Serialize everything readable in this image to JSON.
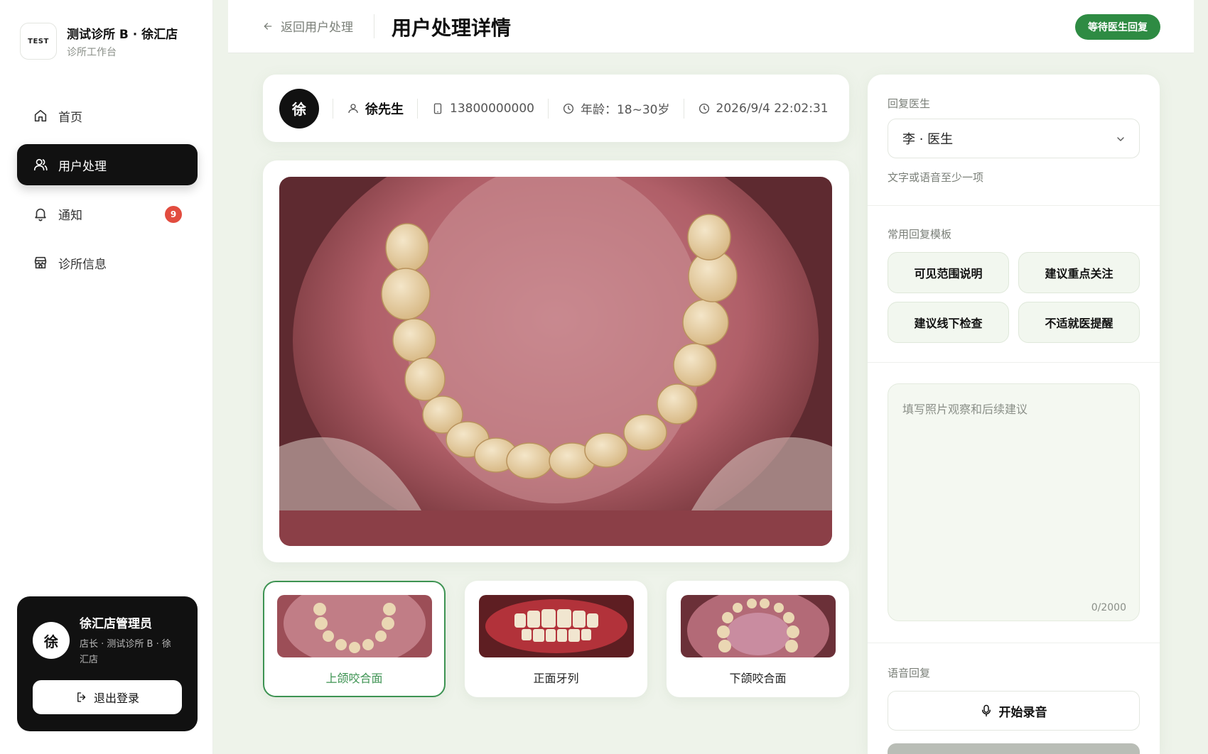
{
  "brand": {
    "logo_text": "TEST",
    "name": "测试诊所 B · 徐汇店",
    "subtitle": "诊所工作台"
  },
  "nav": {
    "items": [
      {
        "label": "首页",
        "icon": "home-icon"
      },
      {
        "label": "用户处理",
        "icon": "user-icon",
        "active": true
      },
      {
        "label": "通知",
        "icon": "bell-icon",
        "badge": "9"
      },
      {
        "label": "诊所信息",
        "icon": "store-icon"
      }
    ]
  },
  "user_card": {
    "avatar": "徐",
    "name": "徐汇店管理员",
    "role": "店长 · 测试诊所 B · 徐汇店",
    "logout_label": "退出登录"
  },
  "header": {
    "back_label": "返回用户处理",
    "title": "用户处理详情",
    "status": "等待医生回复"
  },
  "patient": {
    "avatar": "徐",
    "name": "徐先生",
    "phone": "13800000000",
    "age": "年龄：18~30岁",
    "time": "2026/9/4 22:02:31"
  },
  "thumbnails": [
    {
      "label": "上颌咬合面",
      "active": true
    },
    {
      "label": "正面牙列",
      "active": false
    },
    {
      "label": "下颌咬合面",
      "active": false
    }
  ],
  "reply": {
    "doctor_label": "回复医生",
    "doctor_value": "李 · 医生",
    "hint": "文字或语音至少一项",
    "templates_label": "常用回复模板",
    "templates": [
      "可见范围说明",
      "建议重点关注",
      "建议线下检查",
      "不适就医提醒"
    ],
    "textarea_placeholder": "填写照片观察和后续建议",
    "counter": "0/2000",
    "voice_label": "语音回复",
    "record_label": "开始录音"
  },
  "colors": {
    "accent_green": "#2e8b43",
    "active_black": "#111111",
    "badge_red": "#e24c3f"
  }
}
